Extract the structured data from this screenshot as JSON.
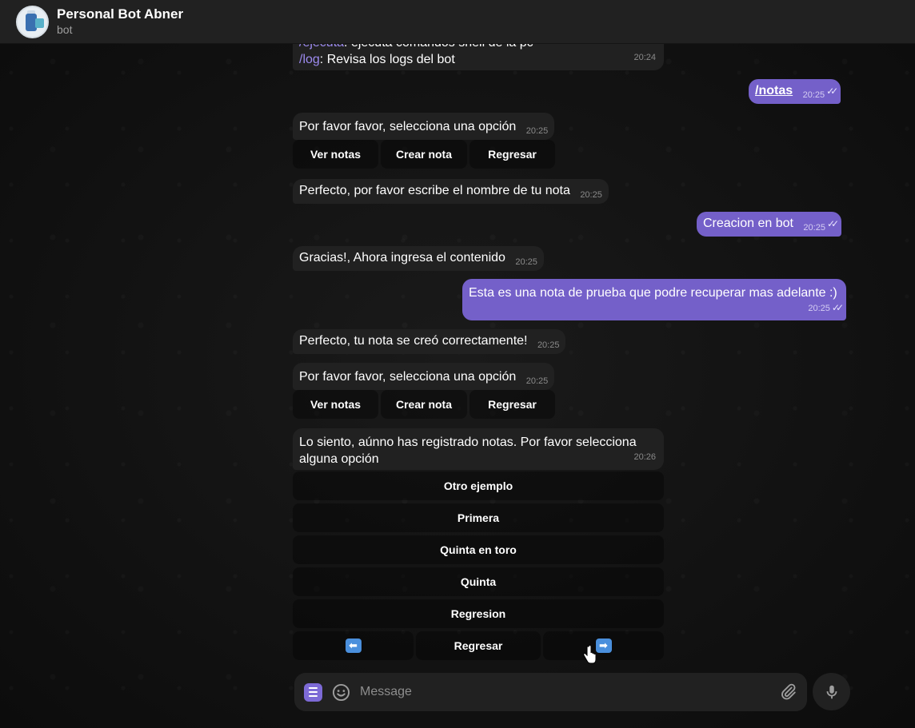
{
  "header": {
    "title": "Personal Bot Abner",
    "subtitle": "bot"
  },
  "messages": {
    "m0": {
      "line1_cmd": "/ejecuta",
      "line1_text": ": ejecuta comandos shell de la pc",
      "line2_cmd": "/log",
      "line2_text": ": Revisa los logs del bot",
      "time": "20:24"
    },
    "m1": {
      "text": "/notas",
      "time": "20:25"
    },
    "m2": {
      "text": "Por favor favor, selecciona una opción",
      "time": "20:25"
    },
    "m3": {
      "text": "Perfecto, por favor escribe el nombre de tu nota",
      "time": "20:25"
    },
    "m4": {
      "text": "Creacion en bot",
      "time": "20:25"
    },
    "m5": {
      "text": "Gracias!, Ahora ingresa el contenido",
      "time": "20:25"
    },
    "m6": {
      "text": "Esta es una nota de prueba que podre recuperar mas adelante  :)",
      "time": "20:25"
    },
    "m7": {
      "text": "Perfecto, tu nota se creó correctamente!",
      "time": "20:25"
    },
    "m8": {
      "text": "Por favor favor, selecciona una opción",
      "time": "20:25"
    },
    "m9": {
      "text": "Lo siento, aúnno has registrado notas. Por favor selecciona alguna opción",
      "time": "20:26"
    }
  },
  "keyboards": {
    "notes_menu": [
      "Ver notas",
      "Crear nota",
      "Regresar"
    ],
    "notes_menu_2": [
      "Ver notas",
      "Crear nota",
      "Regresar"
    ],
    "options": [
      "Otro ejemplo",
      "Primera",
      "Quinta en toro",
      "Quinta",
      "Regresion"
    ],
    "nav": {
      "prev": "⬅",
      "back": "Regresar",
      "next": "➡"
    }
  },
  "composer": {
    "placeholder": "Message"
  },
  "icons": {
    "menu": "menu-icon",
    "emoji": "emoji-icon",
    "attach": "paperclip-icon",
    "mic": "microphone-icon",
    "read": "double-check-icon"
  },
  "colors": {
    "outgoing": "#7460c9",
    "incoming": "#212121",
    "accent": "#7d6ad6",
    "command": "#9d8bf0"
  }
}
